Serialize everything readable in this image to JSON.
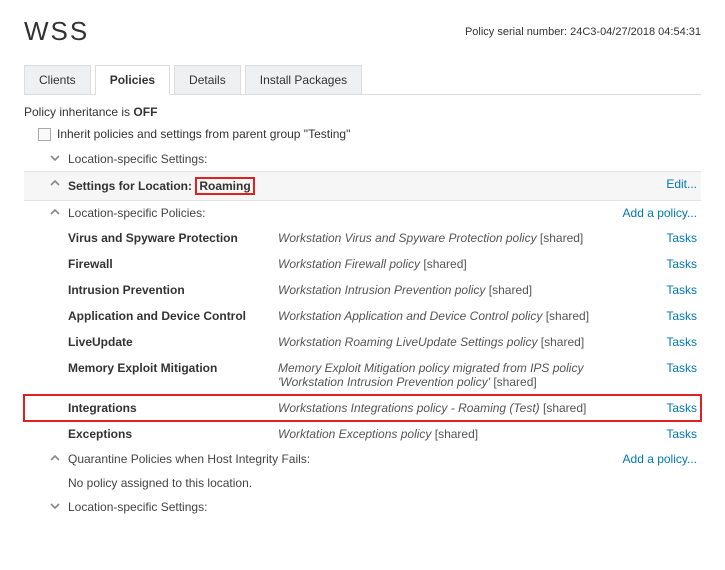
{
  "header": {
    "title": "WSS",
    "serial_label": "Policy serial number:",
    "serial_value": "24C3-04/27/2018 04:54:31"
  },
  "tabs": [
    {
      "label": "Clients",
      "active": false
    },
    {
      "label": "Policies",
      "active": true
    },
    {
      "label": "Details",
      "active": false
    },
    {
      "label": "Install Packages",
      "active": false
    }
  ],
  "inheritance": {
    "prefix": "Policy inheritance is",
    "state": "OFF",
    "checkbox_label": "Inherit policies and settings from parent group \"Testing\""
  },
  "sections": {
    "loc_settings_top": "Location-specific Settings:",
    "settings_for_location_label": "Settings for Location:",
    "settings_for_location_value": "Roaming",
    "edit_link": "Edit...",
    "loc_policies_label": "Location-specific Policies:",
    "add_policy_link": "Add a policy...",
    "quarantine_label": "Quarantine Policies when Host Integrity Fails:",
    "no_policy_assigned": "No policy assigned to this location.",
    "loc_settings_bottom": "Location-specific Settings:"
  },
  "policies": [
    {
      "name": "Virus and Spyware Protection",
      "value": "Workstation Virus and Spyware Protection policy",
      "shared": "[shared]",
      "link": "Tasks"
    },
    {
      "name": "Firewall",
      "value": "Workstation Firewall policy",
      "shared": "[shared]",
      "link": "Tasks"
    },
    {
      "name": "Intrusion Prevention",
      "value": "Workstation Intrusion Prevention policy",
      "shared": "[shared]",
      "link": "Tasks"
    },
    {
      "name": "Application and Device Control",
      "value": "Workstation Application and Device Control policy",
      "shared": "[shared]",
      "link": "Tasks"
    },
    {
      "name": "LiveUpdate",
      "value": "Workstation Roaming LiveUpdate Settings policy",
      "shared": "[shared]",
      "link": "Tasks"
    },
    {
      "name": "Memory Exploit Mitigation",
      "value": "Memory Exploit Mitigation policy migrated from IPS policy 'Workstation Intrusion Prevention policy'",
      "shared": "[shared]",
      "link": "Tasks"
    },
    {
      "name": "Integrations",
      "value": "Workstations Integrations policy - Roaming (Test)",
      "shared": "[shared]",
      "link": "Tasks",
      "highlight": true
    },
    {
      "name": "Exceptions",
      "value": "Worktation Exceptions policy",
      "shared": "[shared]",
      "link": "Tasks"
    }
  ]
}
